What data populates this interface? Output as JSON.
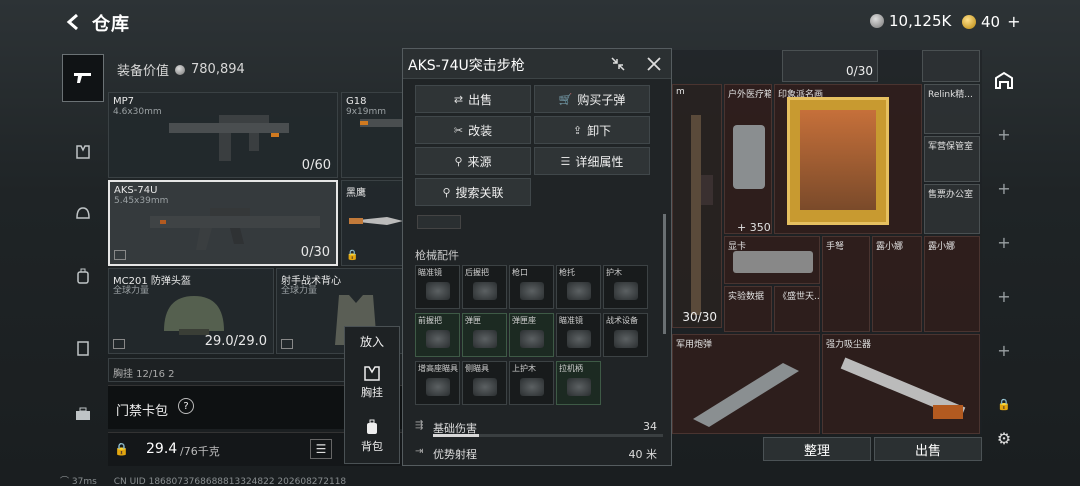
{
  "header": {
    "back_icon": "back-arrow-icon",
    "title": "仓库",
    "silver_amount": "10,125K",
    "gold_amount": "40",
    "gold_plus": "+"
  },
  "equipment": {
    "value_label": "装备价值",
    "value": "780,894",
    "slots": [
      {
        "name": "MP7",
        "sub": "4.6x30mm",
        "count": "0/60"
      },
      {
        "name": "G18",
        "sub": "9x19mm"
      },
      {
        "name": "AKS-74U",
        "sub": "5.45x39mm",
        "count": "0/30"
      },
      {
        "name": "黑鹰"
      },
      {
        "name": "MC201 防弹头盔",
        "sub": "全球力量",
        "count": "29.0/29.0"
      },
      {
        "name": "射手战术背心",
        "sub": "全球力量"
      }
    ],
    "partial_row": "胸挂 12/16 2",
    "keycard_label": "门禁卡包",
    "keycard_help": "?",
    "weight_value": "29.4",
    "weight_max": "/76千克"
  },
  "context_menu": {
    "place_label": "放入",
    "chest_label": "胸挂",
    "backpack_label": "背包"
  },
  "popup": {
    "title": "AKS-74U突击步枪",
    "actions": {
      "sell": "出售",
      "buy_ammo": "购买子弹",
      "modify": "改装",
      "unload": "卸下",
      "source": "来源",
      "details": "详细属性",
      "search_related": "搜索关联"
    },
    "attachments_label": "枪械配件",
    "attachments": [
      "瞄准镜",
      "后握把",
      "枪口",
      "枪托",
      "护木",
      "前握把",
      "弹匣",
      "弹匣座",
      "瞄准镜",
      "战术设备",
      "增高座瞄具",
      "侧瞄具",
      "上护木",
      "拉机柄"
    ],
    "stats": [
      {
        "label": "基础伤害",
        "value": "34",
        "fill_fraction": 0.2
      },
      {
        "label": "优势射程",
        "value": "40 米"
      }
    ]
  },
  "warehouse": {
    "top_count": "0/30",
    "items": [
      {
        "label": "户外医疗箱",
        "extra": "+ 350"
      },
      {
        "label": "印象派名画"
      },
      {
        "label": "Relink精..."
      },
      {
        "label": "军营保管室"
      },
      {
        "label": "售票办公室"
      },
      {
        "label": "显卡"
      },
      {
        "label": "手弩"
      },
      {
        "label": "露小娜"
      },
      {
        "label": "露小娜"
      },
      {
        "label": "实验数据"
      },
      {
        "label": "《盛世天..."
      },
      {
        "label": "军用炮弹"
      },
      {
        "label": "强力吸尘器"
      },
      {
        "label": "m"
      },
      {
        "count": "30/30"
      }
    ],
    "sort_label": "整理",
    "sell_label": "出售"
  },
  "statusbar": {
    "ping": "37ms",
    "uid": "CN UID 1868073768688813324822 202608272118"
  }
}
